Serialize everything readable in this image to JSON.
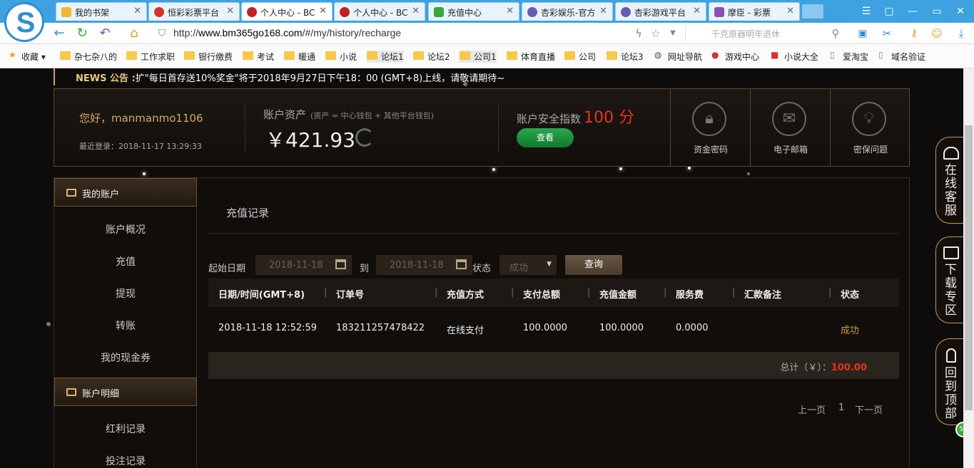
{
  "browser": {
    "tabs": [
      {
        "label": "我的书架",
        "fav_color": "#f2b632"
      },
      {
        "label": "恒彩彩票平台",
        "fav_color": "#d0342c"
      },
      {
        "label": "个人中心 - BC",
        "fav_color": "#c02020"
      },
      {
        "label": "个人中心 - BC",
        "fav_color": "#c02020"
      },
      {
        "label": "充值中心",
        "fav_color": "#3aa838"
      },
      {
        "label": "杏彩娱乐-官方",
        "fav_color": "#6a5ab5"
      },
      {
        "label": "杏彩游戏平台",
        "fav_color": "#6a5ab5"
      },
      {
        "label": "摩臣 - 彩票",
        "fav_color": "#8a4fb5"
      }
    ],
    "url_prefix": "http://",
    "url_host": "www.bm365go168.com",
    "url_path": "/#/my/history/recharge",
    "search_placeholder": "千克原器明年退休",
    "bookmarks": [
      "收藏",
      "杂七杂八的",
      "工作求职",
      "银行缴费",
      "考试",
      "暖通",
      "小说",
      "论坛1",
      "论坛2",
      "公司1",
      "体育直播",
      "公司",
      "论坛3",
      "网址导航",
      "游戏中心",
      "小说大全",
      "爱淘宝",
      "域名验证"
    ]
  },
  "page": {
    "news_label": "NEWS 公告 :",
    "news_text": "扩\"每日首存送10%奖金\"将于2018年9月27日下午18：00 (GMT+8)上线，请敬请期待~",
    "greeting": "您好，manmanmo1106",
    "last_login": "最近登录：2018-11-17 13:29:33",
    "assets_title": "账户资产",
    "assets_note": "(资产 = 中心钱包 + 其他平台钱包)",
    "assets_value": "￥421.93",
    "security_label": "账户安全指数",
    "security_score": "100 分",
    "view_button": "查看",
    "quick_buttons": [
      {
        "label": "资金密码",
        "icon": "lock-icon"
      },
      {
        "label": "电子邮箱",
        "icon": "mail-icon"
      },
      {
        "label": "密保问题",
        "icon": "bulb-icon"
      }
    ],
    "sidebar": {
      "section1": "我的账户",
      "items1": [
        "账户概况",
        "充值",
        "提现",
        "转账",
        "我的现金券"
      ],
      "section2": "账户明细",
      "items2": [
        "红利记录",
        "投注记录"
      ]
    },
    "content_title": "充值记录",
    "filter": {
      "start_label": "起始日期",
      "start_value": "2018-11-18",
      "to_label": "到",
      "end_value": "2018-11-18",
      "status_label": "状态",
      "status_value": "成功",
      "query_button": "查询"
    },
    "table": {
      "headers": [
        "日期/时间(GMT+8)",
        "订单号",
        "充值方式",
        "支付总额",
        "充值金额",
        "服务费",
        "汇款备注",
        "状态"
      ],
      "row": [
        "2018-11-18 12:52:59",
        "183211257478422",
        "在线支付",
        "100.0000",
        "100.0000",
        "0.0000",
        "",
        "成功"
      ]
    },
    "total_label": "总计（￥）：",
    "total_value": "100.00",
    "pager": {
      "prev": "上一页",
      "page": "1",
      "next": "下一页"
    },
    "float_buttons": [
      "在线客服",
      "下载专区",
      "回到顶部"
    ],
    "badge": "59"
  }
}
